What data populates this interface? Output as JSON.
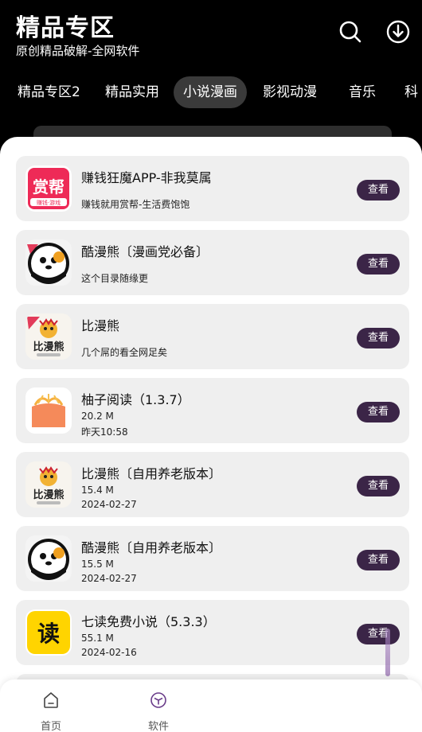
{
  "header": {
    "title": "精品专区",
    "subtitle": "原创精品破解-全网软件",
    "search_icon": "search-icon",
    "download_icon": "download-icon"
  },
  "tabs": [
    {
      "label": "精品专区2",
      "active": false
    },
    {
      "label": "精品实用",
      "active": false
    },
    {
      "label": "小说漫画",
      "active": true
    },
    {
      "label": "影视动漫",
      "active": false
    },
    {
      "label": "音乐",
      "active": false
    },
    {
      "label": "科",
      "active": false
    }
  ],
  "items": [
    {
      "name": "赚钱狂魔APP-非我莫属",
      "desc": "赚钱就用赏帮-生活费饱饱",
      "size": "",
      "date": "",
      "button": "查看",
      "icon_text": "赏帮",
      "icon_sub": "赚钱·游戏"
    },
    {
      "name": "酷漫熊〔漫画党必备〕",
      "desc": "这个目录随缘更",
      "size": "",
      "date": "",
      "button": "查看"
    },
    {
      "name": "比漫熊",
      "desc": "几个屌的看全网足矣",
      "size": "",
      "date": "",
      "button": "查看",
      "icon_text": "比漫熊"
    },
    {
      "name": "柚子阅读（1.3.7）",
      "desc": "",
      "size": "20.2 M",
      "date": "昨天10:58",
      "button": "查看"
    },
    {
      "name": "比漫熊〔自用养老版本〕",
      "desc": "",
      "size": "15.4 M",
      "date": "2024-02-27",
      "button": "查看",
      "icon_text": "比漫熊"
    },
    {
      "name": "酷漫熊〔自用养老版本〕",
      "desc": "",
      "size": "15.5 M",
      "date": "2024-02-27",
      "button": "查看"
    },
    {
      "name": "七读免费小说（5.3.3）",
      "desc": "",
      "size": "55.1 M",
      "date": "2024-02-16",
      "button": "查看",
      "icon_text": "读"
    }
  ],
  "bottom_nav": [
    {
      "label": "首页",
      "icon": "home-icon"
    },
    {
      "label": "软件",
      "icon": "box-icon"
    }
  ],
  "colors": {
    "background": "#000000",
    "button": "#3b2547",
    "card": "#efefef"
  }
}
